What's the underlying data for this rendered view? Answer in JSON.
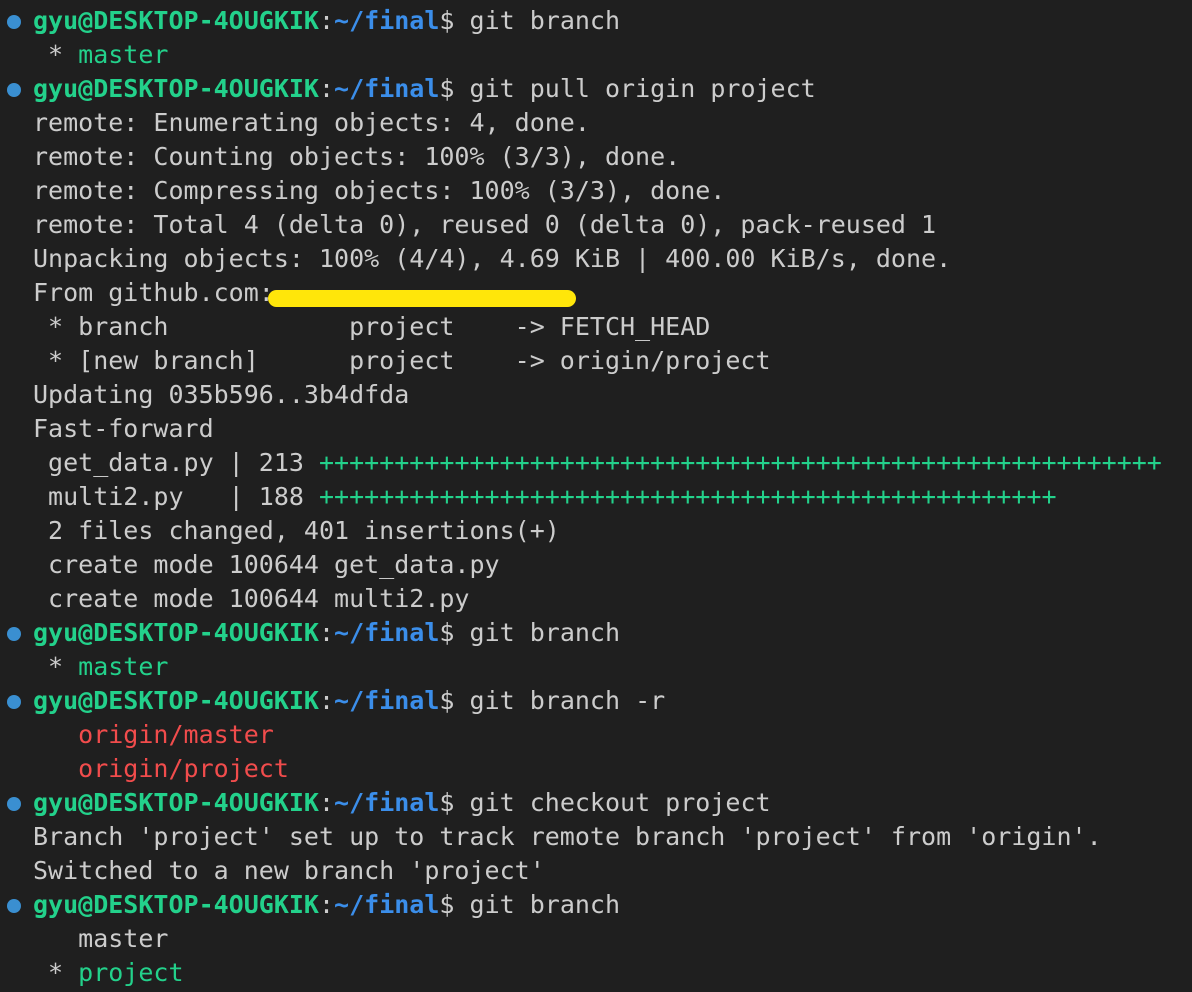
{
  "prompt": {
    "user_host": "gyu@DESKTOP-4OUGKIK",
    "colon": ":",
    "path": "~/final",
    "dollar": "$"
  },
  "lines": [
    {
      "kind": "prompt",
      "cmd": " git branch"
    },
    {
      "kind": "branch_current",
      "prefix": " * ",
      "name": "master"
    },
    {
      "kind": "prompt",
      "cmd": " git pull origin project"
    },
    {
      "kind": "text",
      "text": "remote: Enumerating objects: 4, done."
    },
    {
      "kind": "text",
      "text": "remote: Counting objects: 100% (3/3), done."
    },
    {
      "kind": "text",
      "text": "remote: Compressing objects: 100% (3/3), done."
    },
    {
      "kind": "text",
      "text": "remote: Total 4 (delta 0), reused 0 (delta 0), pack-reused 1"
    },
    {
      "kind": "text",
      "text": "Unpacking objects: 100% (4/4), 4.69 KiB | 400.00 KiB/s, done."
    },
    {
      "kind": "redacted",
      "text": "From github.com:"
    },
    {
      "kind": "text",
      "text": " * branch            project    -> FETCH_HEAD"
    },
    {
      "kind": "text",
      "text": " * [new branch]      project    -> origin/project"
    },
    {
      "kind": "text",
      "text": "Updating 035b596..3b4dfda"
    },
    {
      "kind": "text",
      "text": "Fast-forward"
    },
    {
      "kind": "diffstat",
      "text": " get_data.py | 213 ",
      "plus": "++++++++++++++++++++++++++++++++++++++++++++++++++++++++"
    },
    {
      "kind": "diffstat",
      "text": " multi2.py   | 188 ",
      "plus": "+++++++++++++++++++++++++++++++++++++++++++++++++"
    },
    {
      "kind": "text",
      "text": " 2 files changed, 401 insertions(+)"
    },
    {
      "kind": "text",
      "text": " create mode 100644 get_data.py"
    },
    {
      "kind": "text",
      "text": " create mode 100644 multi2.py"
    },
    {
      "kind": "prompt",
      "cmd": " git branch"
    },
    {
      "kind": "branch_current",
      "prefix": " * ",
      "name": "master"
    },
    {
      "kind": "prompt",
      "cmd": " git branch -r"
    },
    {
      "kind": "branch_remote",
      "prefix": "   ",
      "name": "origin/master"
    },
    {
      "kind": "branch_remote",
      "prefix": "   ",
      "name": "origin/project"
    },
    {
      "kind": "prompt",
      "cmd": " git checkout project"
    },
    {
      "kind": "text",
      "text": "Branch 'project' set up to track remote branch 'project' from 'origin'."
    },
    {
      "kind": "text",
      "text": "Switched to a new branch 'project'"
    },
    {
      "kind": "prompt",
      "cmd": " git branch"
    },
    {
      "kind": "text",
      "text": "   master"
    },
    {
      "kind": "branch_current",
      "prefix": " * ",
      "name": "project"
    }
  ],
  "colors": {
    "background": "#1f1f1f",
    "text": "#cccccc",
    "user_host": "#23d18b",
    "path": "#3b8eea",
    "current_branch": "#23d18b",
    "remote_branch": "#f14c4c",
    "diff_plus": "#23d18b",
    "prompt_dot": "#3a8fd1",
    "redaction": "#ffe60a"
  }
}
